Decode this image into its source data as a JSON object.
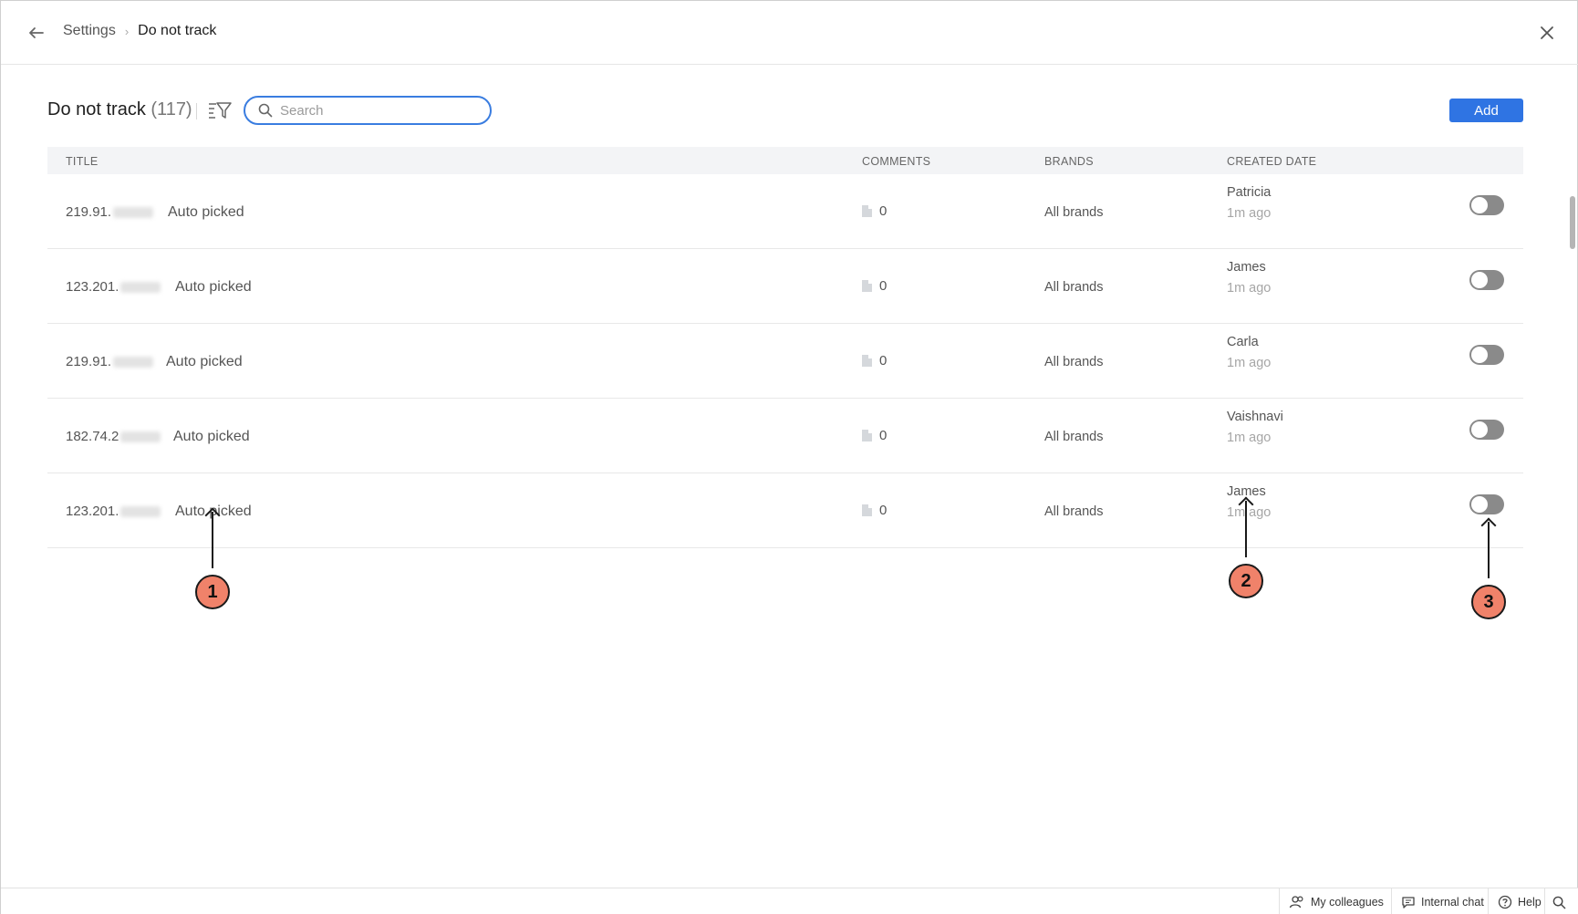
{
  "breadcrumb": {
    "parent": "Settings",
    "current": "Do not track"
  },
  "page": {
    "title": "Do not track",
    "count": "(117)"
  },
  "search": {
    "placeholder": "Search"
  },
  "actions": {
    "add_label": "Add"
  },
  "table": {
    "columns": {
      "title": "TITLE",
      "comments": "COMMENTS",
      "brands": "BRANDS",
      "created": "CREATED DATE"
    },
    "rows": [
      {
        "ip": "219.91.",
        "type": "Auto picked",
        "comments": "0",
        "brands": "All brands",
        "by": "Patricia",
        "when": "1m ago",
        "enabled": false
      },
      {
        "ip": "123.201.",
        "type": "Auto picked",
        "comments": "0",
        "brands": "All brands",
        "by": "James",
        "when": "1m ago",
        "enabled": false
      },
      {
        "ip": "219.91.",
        "type": "Auto picked",
        "comments": "0",
        "brands": "All brands",
        "by": "Carla",
        "when": "1m ago",
        "enabled": false
      },
      {
        "ip": "182.74.2",
        "type": "Auto picked",
        "comments": "0",
        "brands": "All brands",
        "by": "Vaishnavi",
        "when": "1m ago",
        "enabled": false
      },
      {
        "ip": "123.201.",
        "type": "Auto picked",
        "comments": "0",
        "brands": "All brands",
        "by": "James",
        "when": "1m ago",
        "enabled": false
      }
    ]
  },
  "annotations": {
    "one": "1",
    "two": "2",
    "three": "3"
  },
  "footer": {
    "colleagues": "My colleagues",
    "chat": "Internal chat",
    "help": "Help"
  },
  "icons": {
    "back": "arrow-left-icon",
    "close": "close-icon",
    "filter": "filter-icon",
    "search": "search-icon",
    "doc": "document-icon",
    "colleagues": "people-icon",
    "chat": "chat-icon",
    "help": "help-icon"
  },
  "colors": {
    "accent": "#2f74e3",
    "badge": "#f0826a",
    "toggle_off": "#8a8a8a"
  }
}
